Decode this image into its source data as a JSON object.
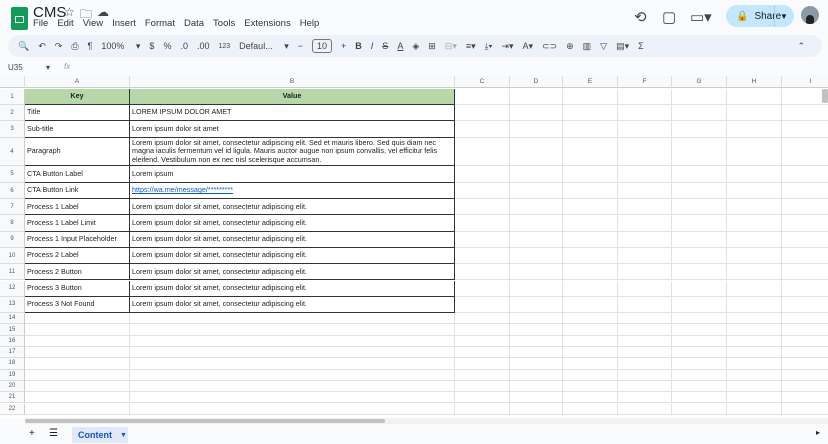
{
  "app": {
    "title": "CMS",
    "menu": [
      "File",
      "Edit",
      "View",
      "Insert",
      "Format",
      "Data",
      "Tools",
      "Extensions",
      "Help"
    ],
    "share_label": "Share"
  },
  "toolbar": {
    "zoom": "100%",
    "currency": "$",
    "percent": "%",
    "dec_dec": ".0",
    "inc_dec": ".00",
    "format": "123",
    "font": "Defaul...",
    "font_size": "10"
  },
  "formula_bar": {
    "cell_ref": "U35",
    "fx": "fx"
  },
  "columns": [
    "A",
    "B",
    "C",
    "D",
    "E",
    "F",
    "G",
    "H",
    "I"
  ],
  "header_row": {
    "key": "Key",
    "value": "Value"
  },
  "rows": [
    {
      "key": "Title",
      "value": "LOREM IPSUM DOLOR AMET"
    },
    {
      "key": "Sub-title",
      "value": "Lorem ipsum dolor sit amet"
    },
    {
      "key": "Paragraph",
      "value": "Lorem ipsum dolor sit amet, consectetur adipiscing elit. Sed et mauris libero. Sed quis diam nec magna iaculis fermentum vel id ligula. Mauris auctor augue non ipsum convallis, vel efficitur felis eleifend. Vestibulum non ex nec nisl scelerisque accumsan."
    },
    {
      "key": "CTA Button Label",
      "value": "Lorem ipsum"
    },
    {
      "key": "CTA Button Link",
      "value": "https://wa.me/message/*********",
      "link": true
    },
    {
      "key": "Process 1 Label",
      "value": "Lorem ipsum dolor sit amet, consectetur adipiscing elit."
    },
    {
      "key": "Process 1 Label Limit",
      "value": "Lorem ipsum dolor sit amet, consectetur adipiscing elit."
    },
    {
      "key": "Process 1 Input Placeholder",
      "value": "Lorem ipsum dolor sit amet, consectetur adipiscing elit."
    },
    {
      "key": "Process 2 Label",
      "value": "Lorem ipsum dolor sit amet, consectetur adipiscing elit."
    },
    {
      "key": "Process 2 Button",
      "value": "Lorem ipsum dolor sit amet, consectetur adipiscing elit."
    },
    {
      "key": "Process 3 Button",
      "value": "Lorem ipsum dolor sit amet, consectetur adipiscing elit."
    },
    {
      "key": "Process 3 Not Found",
      "value": "Lorem ipsum dolor sit amet, consectetur adipiscing elit."
    }
  ],
  "row_numbers": [
    "1",
    "2",
    "3",
    "4",
    "5",
    "6",
    "7",
    "8",
    "9",
    "10",
    "11",
    "12",
    "13",
    "14",
    "15",
    "16",
    "17",
    "18",
    "19",
    "20",
    "21",
    "22"
  ],
  "sheets": [
    {
      "label": "Content",
      "active": true
    }
  ],
  "colors": {
    "header_fill": "#b6d7a8",
    "share": "#c2e7ff",
    "link": "#1155cc"
  }
}
